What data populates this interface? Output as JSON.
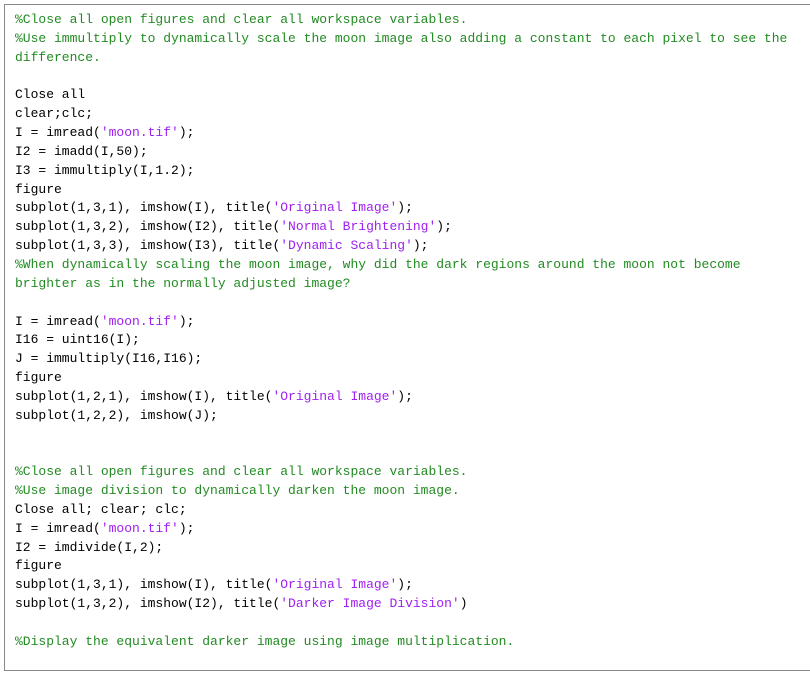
{
  "code": {
    "lines": [
      [
        {
          "cls": "c-comment",
          "t": "%Close all open figures and clear all workspace variables."
        }
      ],
      [
        {
          "cls": "c-comment",
          "t": "%Use immultiply to dynamically scale the moon image also adding a constant to each pixel to see the difference."
        }
      ],
      [
        {
          "cls": "c-default",
          "t": ""
        }
      ],
      [
        {
          "cls": "c-default",
          "t": "Close all"
        }
      ],
      [
        {
          "cls": "c-default",
          "t": "clear;clc;"
        }
      ],
      [
        {
          "cls": "c-default",
          "t": "I = imread("
        },
        {
          "cls": "c-string",
          "t": "'moon.tif'"
        },
        {
          "cls": "c-default",
          "t": ");"
        }
      ],
      [
        {
          "cls": "c-default",
          "t": "I2 = imadd(I,50);"
        }
      ],
      [
        {
          "cls": "c-default",
          "t": "I3 = immultiply(I,1.2);"
        }
      ],
      [
        {
          "cls": "c-default",
          "t": "figure"
        }
      ],
      [
        {
          "cls": "c-default",
          "t": "subplot(1,3,1), imshow(I), title("
        },
        {
          "cls": "c-string",
          "t": "'Original Image'"
        },
        {
          "cls": "c-default",
          "t": ");"
        }
      ],
      [
        {
          "cls": "c-default",
          "t": "subplot(1,3,2), imshow(I2), title("
        },
        {
          "cls": "c-string",
          "t": "'Normal Brightening'"
        },
        {
          "cls": "c-default",
          "t": ");"
        }
      ],
      [
        {
          "cls": "c-default",
          "t": "subplot(1,3,3), imshow(I3), title("
        },
        {
          "cls": "c-string",
          "t": "'Dynamic Scaling'"
        },
        {
          "cls": "c-default",
          "t": ");"
        }
      ],
      [
        {
          "cls": "c-comment",
          "t": "%When dynamically scaling the moon image, why did the dark regions around the moon not become brighter as in the normally adjusted image?"
        }
      ],
      [
        {
          "cls": "c-default",
          "t": ""
        }
      ],
      [
        {
          "cls": "c-default",
          "t": "I = imread("
        },
        {
          "cls": "c-string",
          "t": "'moon.tif'"
        },
        {
          "cls": "c-default",
          "t": ");"
        }
      ],
      [
        {
          "cls": "c-default",
          "t": "I16 = uint16(I);"
        }
      ],
      [
        {
          "cls": "c-default",
          "t": "J = immultiply(I16,I16);"
        }
      ],
      [
        {
          "cls": "c-default",
          "t": "figure"
        }
      ],
      [
        {
          "cls": "c-default",
          "t": "subplot(1,2,1), imshow(I), title("
        },
        {
          "cls": "c-string",
          "t": "'Original Image'"
        },
        {
          "cls": "c-default",
          "t": ");"
        }
      ],
      [
        {
          "cls": "c-default",
          "t": "subplot(1,2,2), imshow(J);"
        }
      ],
      [
        {
          "cls": "c-default",
          "t": ""
        }
      ],
      [
        {
          "cls": "c-default",
          "t": ""
        }
      ],
      [
        {
          "cls": "c-comment",
          "t": "%Close all open figures and clear all workspace variables."
        }
      ],
      [
        {
          "cls": "c-comment",
          "t": "%Use image division to dynamically darken the moon image."
        }
      ],
      [
        {
          "cls": "c-default",
          "t": "Close all; clear; clc;"
        }
      ],
      [
        {
          "cls": "c-default",
          "t": "I = imread("
        },
        {
          "cls": "c-string",
          "t": "'moon.tif'"
        },
        {
          "cls": "c-default",
          "t": ");"
        }
      ],
      [
        {
          "cls": "c-default",
          "t": "I2 = imdivide(I,2);"
        }
      ],
      [
        {
          "cls": "c-default",
          "t": "figure"
        }
      ],
      [
        {
          "cls": "c-default",
          "t": "subplot(1,3,1), imshow(I), title("
        },
        {
          "cls": "c-string",
          "t": "'Original Image'"
        },
        {
          "cls": "c-default",
          "t": ");"
        }
      ],
      [
        {
          "cls": "c-default",
          "t": "subplot(1,3,2), imshow(I2), title("
        },
        {
          "cls": "c-string",
          "t": "'Darker Image Division'"
        },
        {
          "cls": "c-default",
          "t": ")"
        }
      ],
      [
        {
          "cls": "c-default",
          "t": ""
        }
      ],
      [
        {
          "cls": "c-comment",
          "t": "%Display the equivalent darker image using image multiplication."
        }
      ]
    ]
  }
}
